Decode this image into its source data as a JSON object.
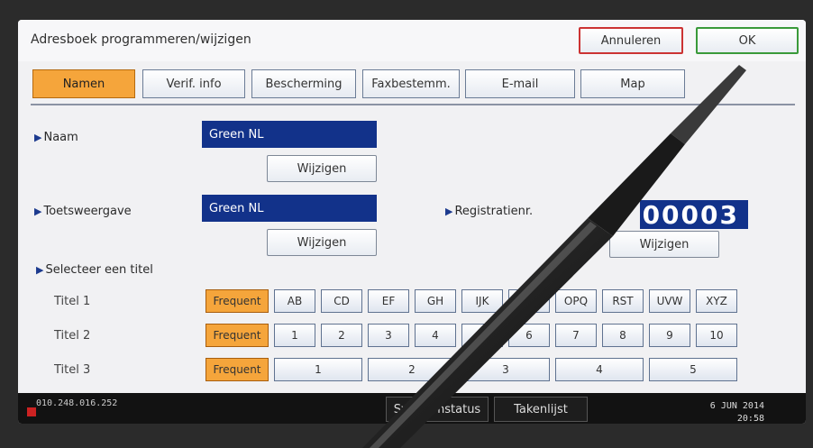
{
  "header": {
    "title": "Adresboek programmeren/wijzigen",
    "cancel_label": "Annuleren",
    "ok_label": "OK"
  },
  "tabs": [
    {
      "label": "Namen",
      "active": true
    },
    {
      "label": "Verif. info",
      "active": false
    },
    {
      "label": "Bescherming",
      "active": false
    },
    {
      "label": "Faxbestemm.",
      "active": false
    },
    {
      "label": "E-mail",
      "active": false
    },
    {
      "label": "Map",
      "active": false
    }
  ],
  "form": {
    "naam_label": "Naam",
    "naam_value": "Green NL",
    "wijzigen1": "Wijzigen",
    "toets_label": "Toetsweergave",
    "toets_value": "Green NL",
    "wijzigen2": "Wijzigen",
    "reg_label": "Registratienr.",
    "reg_value": "00003",
    "wijzigen3": "Wijzigen",
    "titel_label": "Selecteer een titel"
  },
  "titles": {
    "titel1_label": "Titel 1",
    "titel1_keys": [
      "Frequent",
      "AB",
      "CD",
      "EF",
      "GH",
      "IJK",
      "LMN",
      "OPQ",
      "RST",
      "UVW",
      "XYZ"
    ],
    "titel2_label": "Titel 2",
    "titel2_keys": [
      "Frequent",
      "1",
      "2",
      "3",
      "4",
      "5",
      "6",
      "7",
      "8",
      "9",
      "10"
    ],
    "titel3_label": "Titel 3",
    "titel3_keys": [
      "Frequent",
      "1",
      "2",
      "3",
      "4",
      "5"
    ]
  },
  "statusbar": {
    "ip": "010.248.016.252",
    "system_status": "Systeemstatus",
    "takenlijst": "Takenlijst",
    "date": "6 JUN  2014",
    "time": "20:58"
  },
  "colors": {
    "accent": "#f5a53b",
    "field_bg": "#12328a",
    "cancel_border": "#cc3333",
    "ok_border": "#3a9a3a"
  }
}
